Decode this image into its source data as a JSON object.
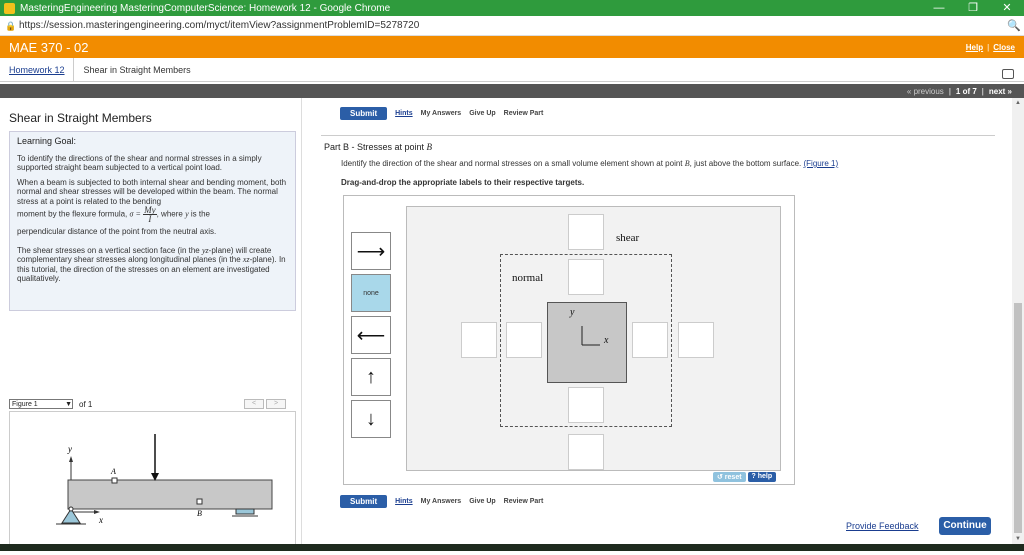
{
  "window": {
    "title": "MasteringEngineering MasteringComputerScience: Homework 12 - Google Chrome",
    "minimize": "—",
    "restore": "❐",
    "close": "✕"
  },
  "browser": {
    "url": "https://session.masteringengineering.com/myct/itemView?assignmentProblemID=5278720",
    "lock_icon": "🔒",
    "search_icon": "🔍"
  },
  "course": {
    "name": "MAE 370 - 02",
    "help": "Help",
    "divider": "|",
    "close": "Close"
  },
  "breadcrumb": {
    "homework": "Homework 12",
    "item": "Shear in Straight Members"
  },
  "nav": {
    "previous": "« previous",
    "position": "1 of 7",
    "next": "next »",
    "sep": "|"
  },
  "left": {
    "title": "Shear in Straight Members",
    "goal_title": "Learning Goal:",
    "goal_p1": "To identify the directions of the shear and normal stresses in a simply supported straight beam subjected to a vertical point load.",
    "goal_p2": "When a beam is subjected to both internal shear and bending moment, both normal and shear stresses will be developed within the beam. The normal stress at a point is related to the bending",
    "goal_p3a": "moment by the flexure formula,",
    "goal_sigma": "σ =",
    "goal_frac_num": "My",
    "goal_frac_den": "I",
    "goal_p3b": ", where",
    "goal_y": "y",
    "goal_p3c": "is the",
    "goal_p4": "perpendicular distance of the point from the neutral axis.",
    "goal_p5a": "The shear stresses on a vertical section face (in the",
    "goal_yz": "yz",
    "goal_p5b": "-plane) will create complementary shear stresses along longitudinal planes (in the",
    "goal_xz": "xz",
    "goal_p5c": "-plane). In this tutorial, the direction of the stresses on an element are investigated qualitatively.",
    "figure_select": "Figure 1",
    "figure_of": "of 1",
    "prev_fig": "<",
    "next_fig": ">"
  },
  "figure": {
    "y_label": "y",
    "x_label": "x",
    "a_label": "A",
    "b_label": "B"
  },
  "toolbar": {
    "submit": "Submit",
    "hints": "Hints",
    "my_answers": "My Answers",
    "give_up": "Give Up",
    "review_part": "Review Part"
  },
  "part": {
    "title": "Part B - Stresses at point ",
    "point": "B",
    "instruction": "Identify the direction of the shear and normal stresses on a small volume element shown at point ",
    "instruction_point": "B",
    "instruction_tail": ", just above the bottom surface. ",
    "figure_link": "(Figure 1)",
    "drag_instruction": "Drag-and-drop the appropriate labels to their respective targets."
  },
  "palette": [
    {
      "name": "arrow-right-label",
      "glyph": "⟶"
    },
    {
      "name": "none-label",
      "glyph": "none"
    },
    {
      "name": "arrow-left-label",
      "glyph": "⟵"
    },
    {
      "name": "arrow-up-label",
      "glyph": "↑"
    },
    {
      "name": "arrow-down-label",
      "glyph": "↓"
    }
  ],
  "targets": {
    "shear_label": "shear",
    "normal_label": "normal",
    "y_axis": "y",
    "x_axis": "x"
  },
  "actions": {
    "reset": "↺ reset",
    "help": "? help",
    "feedback": "Provide Feedback",
    "continue": "Continue"
  },
  "colors": {
    "title_bar": "#2f9b3d",
    "course_bar": "#f28c00",
    "submit": "#2b5ea7",
    "selected_tile": "#a9d8ea"
  }
}
